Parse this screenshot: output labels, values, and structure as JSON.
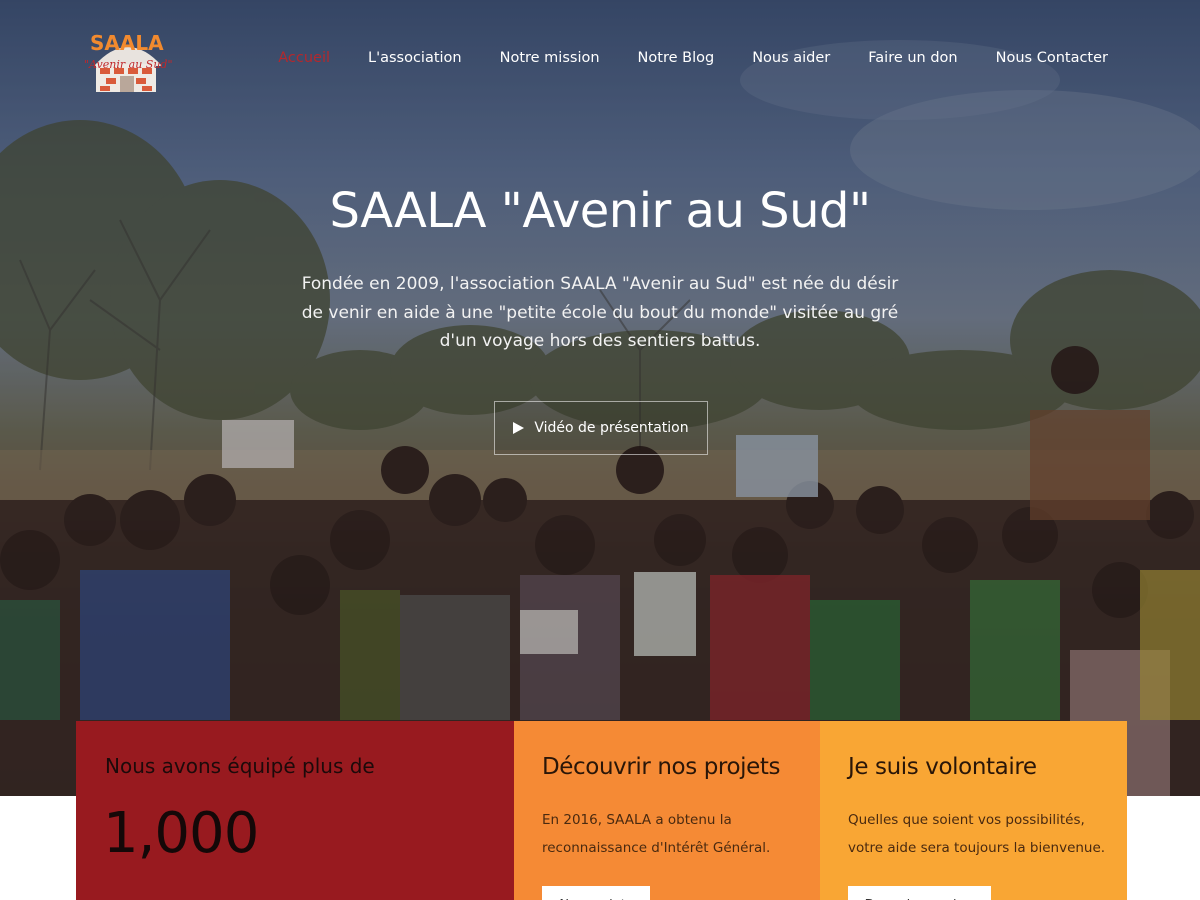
{
  "brand": {
    "logo_text": "SAALA",
    "logo_subtext": "\"Avenir au Sud\""
  },
  "nav": {
    "items": [
      {
        "label": "Accueil",
        "active": true
      },
      {
        "label": "L'association",
        "active": false
      },
      {
        "label": "Notre mission",
        "active": false
      },
      {
        "label": "Notre Blog",
        "active": false
      },
      {
        "label": "Nous aider",
        "active": false
      },
      {
        "label": "Faire un don",
        "active": false
      },
      {
        "label": "Nous Contacter",
        "active": false
      }
    ]
  },
  "hero": {
    "title": "SAALA \"Avenir au Sud\"",
    "description": "Fondée en 2009, l'association SAALA \"Avenir au Sud\" est née du désir de venir en aide à une \"petite école du bout du monde\" visitée au gré d'un voyage hors des sentiers battus.",
    "video_button": "Vidéo de présentation",
    "video_icon": "play-icon"
  },
  "cards": {
    "stat": {
      "label": "Nous avons équipé plus de",
      "number": "1,000"
    },
    "projects": {
      "title": "Découvrir nos projets",
      "text": "En 2016, SAALA a obtenu la reconnaissance d'Intérêt Général.",
      "button": "Nos projets"
    },
    "volunteer": {
      "title": "Je suis volontaire",
      "text": "Quelles que soient vos possibilités, votre aide sera toujours la bienvenue.",
      "button": "Devenir membre"
    }
  },
  "colors": {
    "accent_red": "#b3282d",
    "card_red": "#981a1f",
    "card_orange": "#f58a35",
    "card_yellow": "#f9a634"
  }
}
